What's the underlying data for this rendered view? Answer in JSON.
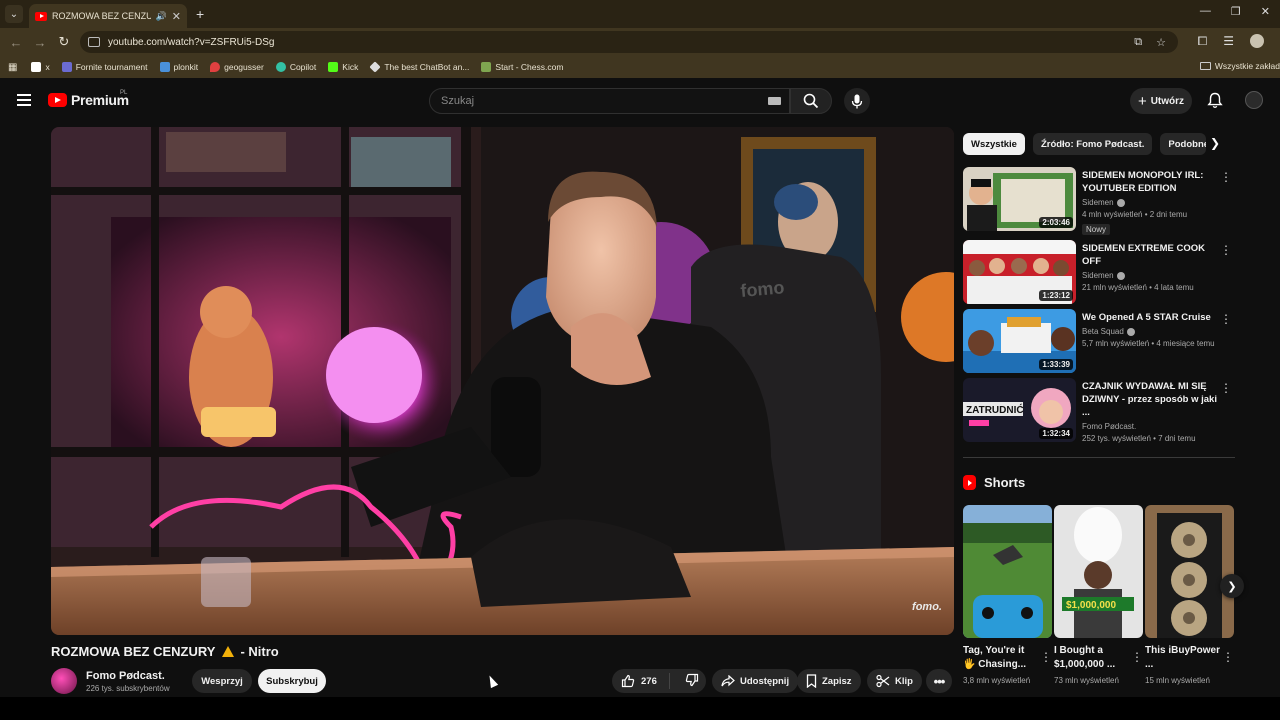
{
  "browser": {
    "tab_title": "ROZMOWA BEZ CENZURY ,",
    "url": "youtube.com/watch?v=ZSFRUi5-DSg",
    "bookmarks": [
      {
        "label": "x",
        "color": "#ffffff"
      },
      {
        "label": "Fornite tournament",
        "color": "#6b6bd1"
      },
      {
        "label": "plonkit",
        "color": "#4a90d9"
      },
      {
        "label": "geogusser",
        "color": "#e04040"
      },
      {
        "label": "Copilot",
        "color": "#33c1a4"
      },
      {
        "label": "Kick",
        "color": "#53fc18"
      },
      {
        "label": "The best ChatBot an...",
        "color": "#dddddd"
      },
      {
        "label": "Start - Chess.com",
        "color": "#7fa650"
      }
    ],
    "bookmarks_folder": "Wszystkie zakład"
  },
  "masthead": {
    "logo": "Premium",
    "country": "PL",
    "search_placeholder": "Szukaj",
    "create_label": "Utwórz"
  },
  "video": {
    "title": "ROZMOWA BEZ CENZURY",
    "title_suffix": "- Nitro",
    "watermark": "fomo.",
    "channel": "Fomo Pødcast.",
    "subscribers": "226 tys. subskrybentów",
    "join_label": "Wesprzyj",
    "subscribe_label": "Subskrybuj",
    "likes": "276",
    "share_label": "Udostępnij",
    "save_label": "Zapisz",
    "clip_label": "Klip"
  },
  "sidebar": {
    "chips": [
      "Wszystkie",
      "Źródło: Fomo Pødcast.",
      "Podobne"
    ],
    "recommendations": [
      {
        "title": "SIDEMEN MONOPOLY IRL: YOUTUBER EDITION",
        "channel": "Sidemen",
        "meta": "4 mln wyświetleń • 2 dni temu",
        "duration": "2:03:46",
        "badge": "Nowy"
      },
      {
        "title": "SIDEMEN EXTREME COOK OFF",
        "channel": "Sidemen",
        "meta": "21 mln wyświetleń • 4 lata temu",
        "duration": "1:23:12",
        "badge": ""
      },
      {
        "title": "We Opened A 5 STAR Cruise",
        "channel": "Beta Squad",
        "meta": "5,7 mln wyświetleń • 4 miesiące temu",
        "duration": "1:33:39",
        "badge": ""
      },
      {
        "title": "CZAJNIK WYDAWAŁ MI SIĘ DZIWNY - przez sposób w jaki ...",
        "channel": "Fomo Pødcast.",
        "meta": "252 tys. wyświetleń • 7 dni temu",
        "duration": "1:32:34",
        "badge": ""
      }
    ],
    "shorts_heading": "Shorts",
    "shorts": [
      {
        "title": "Tag, You're it 🖐 Chasing...",
        "views": "3,8 mln wyświetleń"
      },
      {
        "title": "I Bought a $1,000,000 ...",
        "views": "73 mln wyświetleń"
      },
      {
        "title": "This iBuyPower ...",
        "views": "15 mln wyświetleń"
      }
    ]
  }
}
